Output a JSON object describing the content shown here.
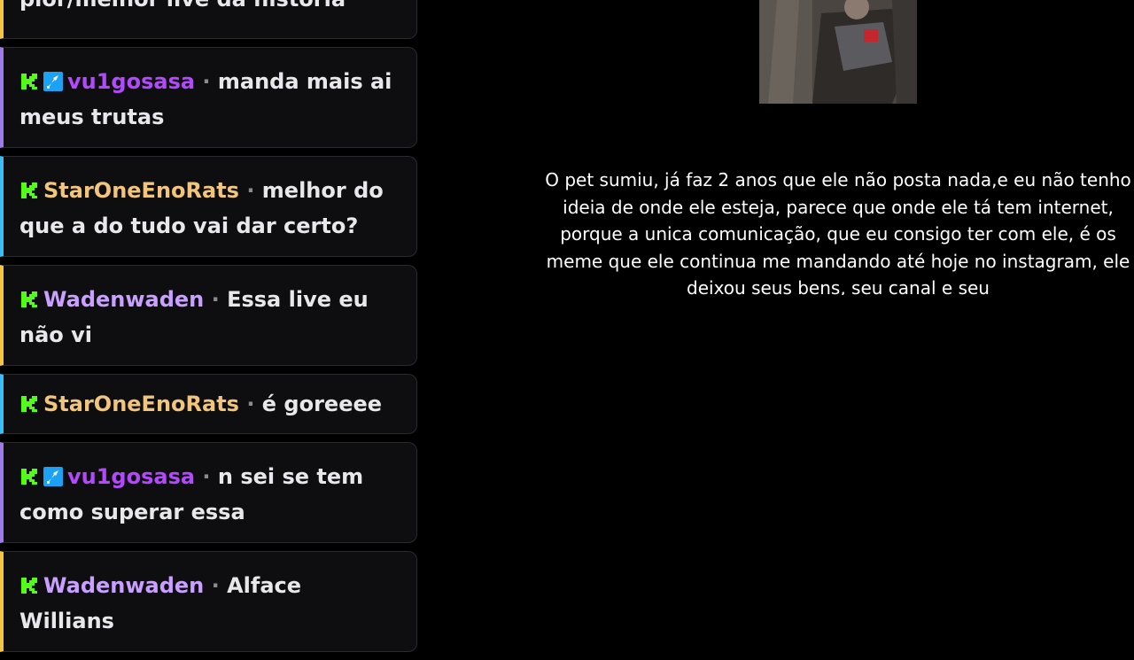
{
  "colors": {
    "background": "#000000",
    "card_bg": "#0e0e11",
    "kick_green": "#53fc18",
    "mod_blue": "#1da1f2",
    "purple_user": "#b448ff",
    "gold_user": "#f2c57c",
    "lavender_user": "#c9a0ff"
  },
  "chat": {
    "messages": [
      {
        "id": "partial-top",
        "badges": [],
        "user": "",
        "text": "pior/melhor live da história",
        "border": "#f5c542",
        "user_color": ""
      },
      {
        "id": "vulgosasa-1",
        "badges": [
          "kick-verified-icon",
          "moderator-sword-icon"
        ],
        "user": "vu1gosasa",
        "text": "manda mais ai meus trutas",
        "border": "#9f7aea",
        "user_color": "#b448ff"
      },
      {
        "id": "starone-1",
        "badges": [
          "kick-verified-icon"
        ],
        "user": "StarOneEnoRats",
        "text": "melhor do que a do tudo vai dar certo?",
        "border": "#38bdf8",
        "user_color": "#f2c57c"
      },
      {
        "id": "wadenwaden-1",
        "badges": [
          "kick-verified-icon"
        ],
        "user": "Wadenwaden",
        "text": "Essa live eu não vi",
        "border": "#f5c542",
        "user_color": "#c9a0ff"
      },
      {
        "id": "starone-2",
        "badges": [
          "kick-verified-icon"
        ],
        "user": "StarOneEnoRats",
        "text": "é goreeee",
        "border": "#38bdf8",
        "user_color": "#f2c57c"
      },
      {
        "id": "vulgosasa-2",
        "badges": [
          "kick-verified-icon",
          "moderator-sword-icon"
        ],
        "user": "vu1gosasa",
        "text": "n sei se tem como superar essa",
        "border": "#9f7aea",
        "user_color": "#b448ff"
      },
      {
        "id": "wadenwaden-2",
        "badges": [
          "kick-verified-icon"
        ],
        "user": "Wadenwaden",
        "text": "Alface Willians",
        "border": "#f5c542",
        "user_color": "#c9a0ff"
      }
    ],
    "separator": "·"
  },
  "caption": {
    "text": "O pet sumiu, já faz 2 anos que ele não posta nada,e eu não tenho ideia de onde ele esteja, parece que onde ele tá tem internet, porque a unica comunicação, que eu consigo ter com ele, é os meme que ele continua me mandando até hoje no instagram, ele deixou seus bens, seu canal e seu"
  },
  "video": {
    "icon": "video-thumbnail"
  }
}
